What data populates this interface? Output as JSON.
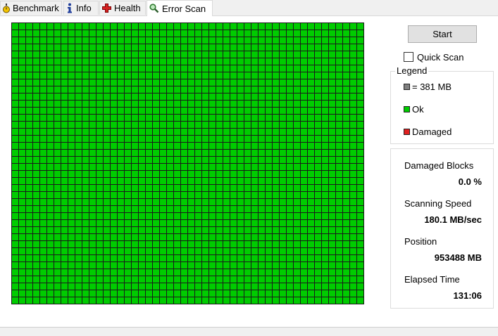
{
  "tabs": [
    {
      "label": "Benchmark",
      "icon": "stopwatch-icon"
    },
    {
      "label": "Info",
      "icon": "info-icon"
    },
    {
      "label": "Health",
      "icon": "health-cross-icon"
    },
    {
      "label": "Error Scan",
      "icon": "magnifier-icon",
      "active": true
    }
  ],
  "scan_grid": {
    "ok_color": "#00cc00",
    "damaged_color": "#e02020",
    "block_color": "#808080",
    "line_color": "#1a1a1a"
  },
  "controls": {
    "start_label": "Start",
    "quick_scan_label": "Quick Scan",
    "quick_scan_checked": false
  },
  "legend": {
    "title": "Legend",
    "items": [
      {
        "label": "= 381 MB",
        "color": "#808080"
      },
      {
        "label": "Ok",
        "color": "#00cc00"
      },
      {
        "label": "Damaged",
        "color": "#e02020"
      }
    ]
  },
  "stats": {
    "damaged_blocks_label": "Damaged Blocks",
    "damaged_blocks_value": "0.0 %",
    "scanning_speed_label": "Scanning Speed",
    "scanning_speed_value": "180.1 MB/sec",
    "position_label": "Position",
    "position_value": "953488 MB",
    "elapsed_time_label": "Elapsed Time",
    "elapsed_time_value": "131:06"
  }
}
